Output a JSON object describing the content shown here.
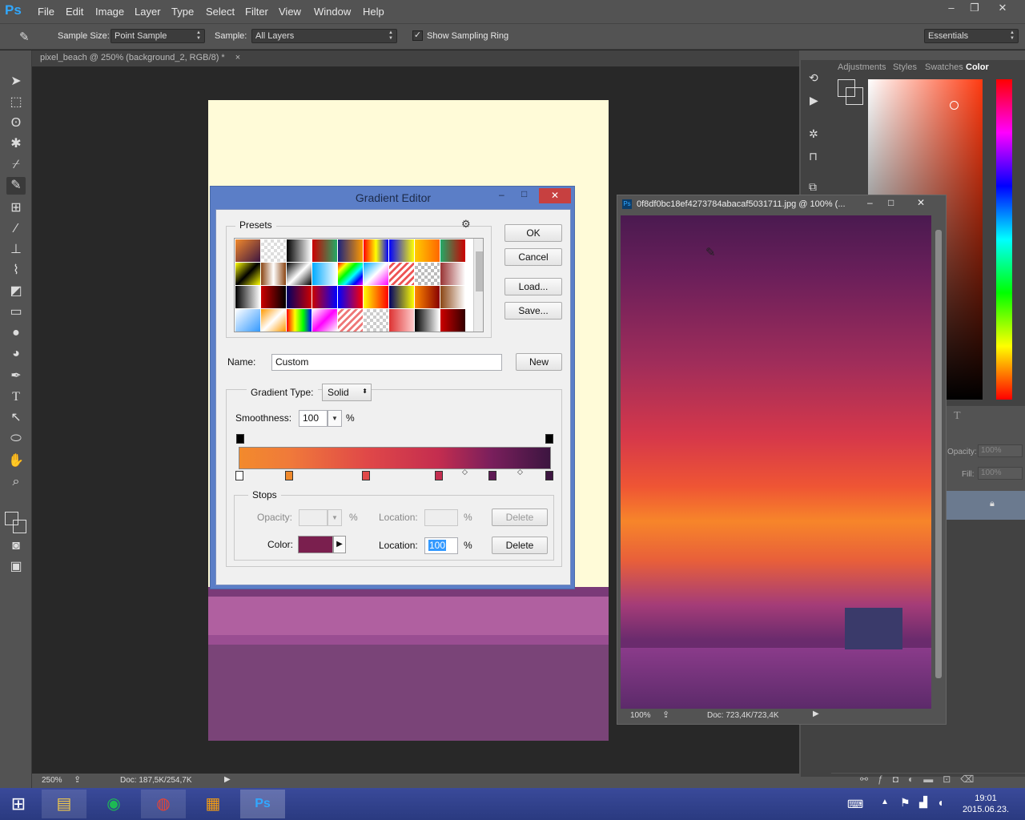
{
  "app": {
    "logo": "Ps"
  },
  "menu": [
    "File",
    "Edit",
    "Image",
    "Layer",
    "Type",
    "Select",
    "Filter",
    "View",
    "Window",
    "Help"
  ],
  "window_controls": {
    "minimize": "–",
    "restore": "❐",
    "close": "✕"
  },
  "options": {
    "sample_size_label": "Sample Size:",
    "sample_size_value": "Point Sample",
    "sample_label": "Sample:",
    "sample_value": "All Layers",
    "show_ring_label": "Show Sampling Ring",
    "workspace": "Essentials"
  },
  "doc": {
    "tab_title": "pixel_beach @ 250% (background_2, RGB/8) *",
    "zoom": "250%",
    "doc_size": "Doc: 187,5K/254,7K"
  },
  "panels": {
    "tabs": [
      "Adjustments",
      "Styles",
      "Swatches",
      "Color"
    ],
    "opacity_label": "Opacity:",
    "opacity_value": "100%",
    "fill_label": "Fill:",
    "fill_value": "100%"
  },
  "gradient_editor": {
    "title": "Gradient Editor",
    "presets_label": "Presets",
    "ok": "OK",
    "cancel": "Cancel",
    "load": "Load...",
    "save": "Save...",
    "name_label": "Name:",
    "name_value": "Custom",
    "new": "New",
    "gradient_type_label": "Gradient Type:",
    "gradient_type_value": "Solid",
    "smoothness_label": "Smoothness:",
    "smoothness_value": "100",
    "percent": "%",
    "stops_label": "Stops",
    "opacity_label": "Opacity:",
    "location_label": "Location:",
    "delete": "Delete",
    "color_label": "Color:",
    "color_location_value": "100"
  },
  "image_window": {
    "title": "0f8df0bc18ef4273784abacaf5031711.jpg @ 100% (...",
    "zoom": "100%",
    "doc_size": "Doc: 723,4K/723,4K"
  },
  "taskbar": {
    "time": "19:01",
    "date": "2015.06.23."
  },
  "colors": {
    "foreground": "#e8542c",
    "background": "#5a1a6a",
    "dialog_frame": "#5b7ec7",
    "stop_color": "#7a1f4e"
  }
}
